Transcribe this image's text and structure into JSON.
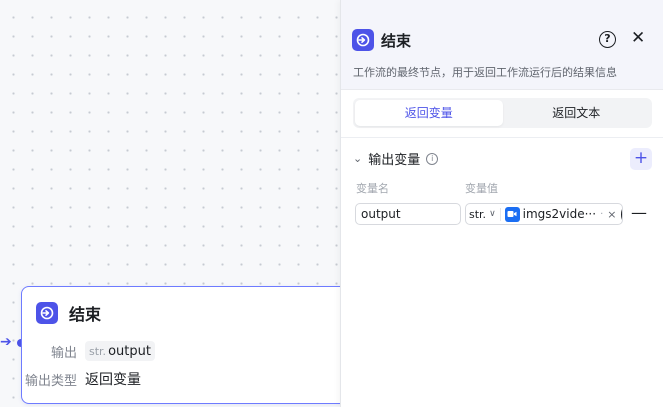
{
  "node": {
    "title": "结束",
    "output_label": "输出",
    "output_type": "str.",
    "output_name": "output",
    "return_type_label": "输出类型",
    "return_type_value": "返回变量"
  },
  "panel": {
    "title": "结束",
    "help_glyph": "?",
    "close_glyph": "✕",
    "description": "工作流的最终节点，用于返回工作流运行后的结果信息",
    "tabs": [
      {
        "label": "返回变量",
        "active": true
      },
      {
        "label": "返回文本",
        "active": false
      }
    ],
    "section_title": "输出变量",
    "info_glyph": "i",
    "add_glyph": "+",
    "col_name": "变量名",
    "col_value": "变量值",
    "row": {
      "name": "output",
      "type": "str.",
      "ref_name": "imgs2vide···",
      "ref_dot": "·",
      "remove_x": "×",
      "minus": "—"
    }
  },
  "colors": {
    "accent": "#4d53e8",
    "video_icon": "#1b6ef3"
  },
  "icons": [
    "end-node-icon",
    "help-icon",
    "close-icon",
    "chevron-down-icon",
    "info-icon",
    "add-icon",
    "camera-icon",
    "target-icon",
    "remove-icon"
  ]
}
